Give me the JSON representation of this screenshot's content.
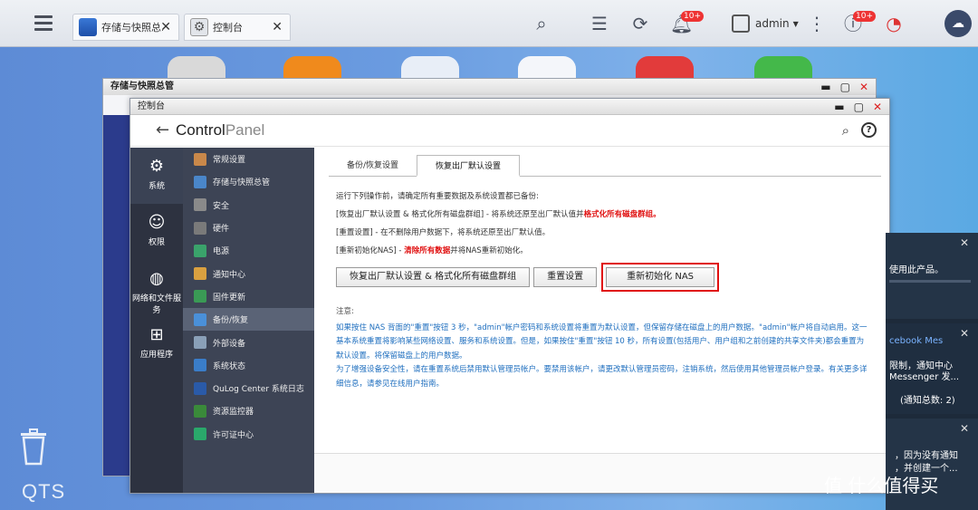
{
  "taskbar": {
    "tabs": [
      {
        "label": "存储与快照总...",
        "icon": "storage-app-icon"
      },
      {
        "label": "控制台",
        "icon": "gear-icon"
      }
    ],
    "notif_badge": "10+",
    "update_badge": "10+",
    "username": "admin"
  },
  "back_window": {
    "title": "存储与快照总管"
  },
  "control_panel": {
    "title": "控制台",
    "logo_part1": "Control",
    "logo_part2": "Panel",
    "categories": [
      {
        "label": "系统",
        "icon": "gear-icon"
      },
      {
        "label": "权限",
        "icon": "user-icon"
      },
      {
        "label": "网络和文件服务",
        "icon": "globe-icon"
      },
      {
        "label": "应用程序",
        "icon": "apps-grid-icon"
      }
    ],
    "sub_items": [
      {
        "label": "常规设置",
        "color": "#c9884a"
      },
      {
        "label": "存储与快照总管",
        "color": "#4a86c9"
      },
      {
        "label": "安全",
        "color": "#8a8a8a"
      },
      {
        "label": "硬件",
        "color": "#7a7a7a"
      },
      {
        "label": "电源",
        "color": "#3aa36b"
      },
      {
        "label": "通知中心",
        "color": "#d9a040"
      },
      {
        "label": "固件更新",
        "color": "#3a9a55"
      },
      {
        "label": "备份/恢复",
        "color": "#4a90d9"
      },
      {
        "label": "外部设备",
        "color": "#8aa0b8"
      },
      {
        "label": "系统状态",
        "color": "#3a7dc9"
      },
      {
        "label": "QuLog Center 系统日志",
        "color": "#2a5aa8"
      },
      {
        "label": "资源监控器",
        "color": "#3a8a3a"
      },
      {
        "label": "许可证中心",
        "color": "#2aa86b"
      }
    ],
    "tabs": [
      "备份/恢复设置",
      "恢复出厂默认设置"
    ],
    "intro": "运行下列操作前，请确定所有重要数据及系统设置都已备份:",
    "line1_a": "[恢复出厂默认设置 & 格式化所有磁盘群组] - 将系统还原至出厂默认值并",
    "line1_red": "格式化所有磁盘群组。",
    "line2": "[重置设置] - 在不删除用户数据下，将系统还原至出厂默认值。",
    "line3_a": "[重新初始化NAS] - ",
    "line3_red": "清除所有数据",
    "line3_b": "并将NAS重新初始化。",
    "buttons": {
      "factory_reset": "恢复出厂默认设置 & 格式化所有磁盘群组",
      "reset_settings": "重置设置",
      "reinit_nas": "重新初始化 NAS"
    },
    "notes_title": "注意:",
    "note1": "如果按住 NAS 背面的\"重置\"按钮 3 秒，\"admin\"帐户密码和系统设置将重置为默认设置，但保留存储在磁盘上的用户数据。\"admin\"帐户将自动启用。这一基本系统重置将影响某些网络设置、服务和系统设置。但是，如果按住\"重置\"按钮 10 秒，所有设置(包括用户、用户组和之前创建的共享文件夹)都会重置为默认设置。将保留磁盘上的用户数据。",
    "note2": "为了增强设备安全性，请在重置系统后禁用默认管理员帐户。要禁用该帐户，请更改默认管理员密码，注销系统，然后使用其他管理员帐户登录。有关更多详细信息，请参见在线用户指南。"
  },
  "notifications": {
    "card1": "使用此产品。",
    "card2_title": "cebook Mes",
    "card2_line1": "限制，通知中心",
    "card2_line2": "Messenger 发...",
    "card2_total": "(通知总数: 2)",
    "card3_line1": "，因为没有通知",
    "card3_line2": "，并创建一个..."
  },
  "desktop": {
    "brand": "QTS",
    "watermark": "值 什么值得买"
  }
}
